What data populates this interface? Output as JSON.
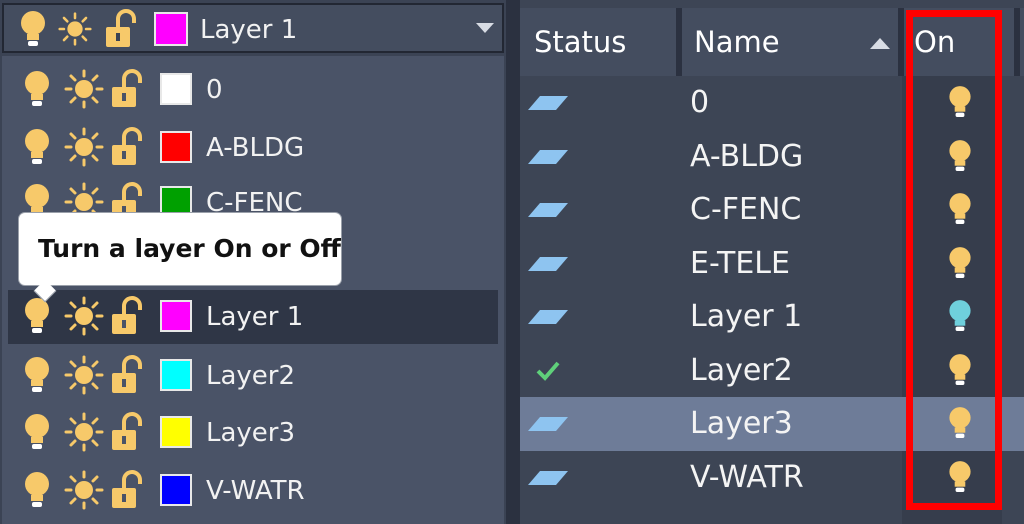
{
  "colors": {
    "accent_highlight": "#ff0000",
    "bulb_on": "#f7c96a",
    "bulb_selected": "#6fd0dc",
    "check": "#5fd07a",
    "status": "#8ec4f0"
  },
  "dropdown": {
    "current": {
      "name": "Layer 1",
      "color": "#ff00ff"
    },
    "tooltip": "Turn a layer On or Off",
    "layers": [
      {
        "name": "0",
        "color": "#ffffff"
      },
      {
        "name": "A-BLDG",
        "color": "#ff0000"
      },
      {
        "name": "C-FENC",
        "color": "#00a000"
      },
      {
        "name": "Layer 1",
        "color": "#ff00ff",
        "selected": true
      },
      {
        "name": "Layer2",
        "color": "#00ffff"
      },
      {
        "name": "Layer3",
        "color": "#ffff00"
      },
      {
        "name": "V-WATR",
        "color": "#0000ff"
      }
    ]
  },
  "table": {
    "headers": {
      "status": "Status",
      "name": "Name",
      "on": "On"
    },
    "rows": [
      {
        "name": "0",
        "status": "layer-icon",
        "on": "bulb-on"
      },
      {
        "name": "A-BLDG",
        "status": "layer-icon",
        "on": "bulb-on"
      },
      {
        "name": "C-FENC",
        "status": "layer-icon",
        "on": "bulb-on"
      },
      {
        "name": "E-TELE",
        "status": "layer-icon",
        "on": "bulb-on"
      },
      {
        "name": "Layer 1",
        "status": "layer-icon",
        "on": "bulb-selected"
      },
      {
        "name": "Layer2",
        "status": "check-icon",
        "on": "bulb-on"
      },
      {
        "name": "Layer3",
        "status": "layer-icon",
        "on": "bulb-on",
        "selected": true
      },
      {
        "name": "V-WATR",
        "status": "layer-icon",
        "on": "bulb-on"
      }
    ]
  }
}
